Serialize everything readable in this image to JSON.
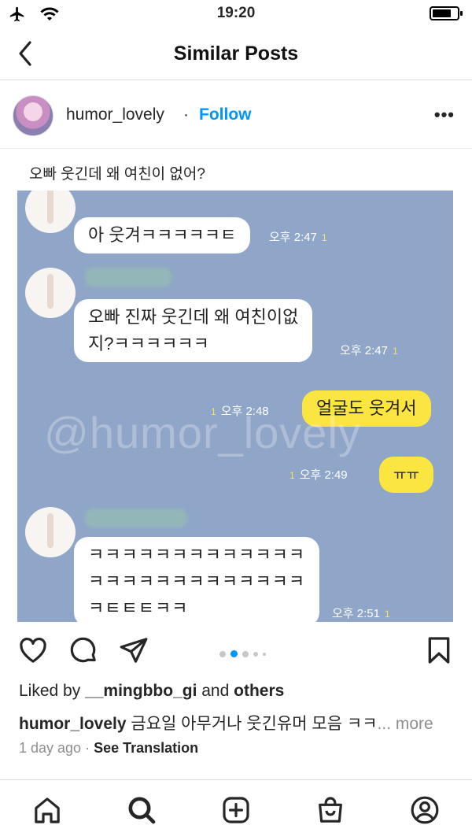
{
  "status_bar": {
    "time": "19:20"
  },
  "nav": {
    "title": "Similar Posts"
  },
  "post": {
    "username": "humor_lovely",
    "separator": "·",
    "follow_label": "Follow",
    "more_label": "•••",
    "image": {
      "caption": "오빠 웃긴데 왜 여친이 없어?",
      "watermark": "@humor_lovely",
      "messages": [
        {
          "text": "아 웃겨ㅋㅋㅋㅋㅋㅌ",
          "time": "오후 2:47",
          "count": "1"
        },
        {
          "text": "오빠 진짜 웃긴데 왜 여친이없\n지?ㅋㅋㅋㅋㅋㅋ",
          "time": "오후 2:47",
          "count": "1"
        },
        {
          "text": "얼굴도 웃겨서",
          "time": "오후 2:48",
          "count": "1"
        },
        {
          "text": "ㅠㅠ",
          "time": "오후 2:49",
          "count": "1"
        },
        {
          "text": "ㅋㅋㅋㅋㅋㅋㅋㅋㅋㅋㅋㅋㅋ\nㅋㅋㅋㅋㅋㅋㅋㅋㅋㅋㅋㅋㅋ\nㅋㅌㅌㅌㅋㅋ",
          "time": "오후 2:51",
          "count": "1"
        }
      ]
    },
    "carousel": {
      "total": 5,
      "active": 1
    },
    "likes": {
      "prefix": "Liked by ",
      "user": "__mingbbo_gi",
      "middle": " and ",
      "others": "others"
    },
    "caption": {
      "user": "humor_lovely",
      "text": " 금요일 아무거나 웃긴유머 모음 ㅋㅋ",
      "more": "... more"
    },
    "time_ago": "1 day ago",
    "time_sep": " · ",
    "see_translation": "See Translation"
  },
  "icons": {
    "back": "chevron-left-icon",
    "like": "heart-icon",
    "comment": "comment-icon",
    "share": "send-icon",
    "save": "bookmark-icon",
    "tabs": [
      "home-icon",
      "search-icon",
      "add-post-icon",
      "shop-icon",
      "profile-icon"
    ]
  },
  "colors": {
    "link": "#0095f6",
    "chat_background": "#8fa6c8",
    "my_bubble": "#fbe540",
    "carousel_active": "#0095f6"
  }
}
